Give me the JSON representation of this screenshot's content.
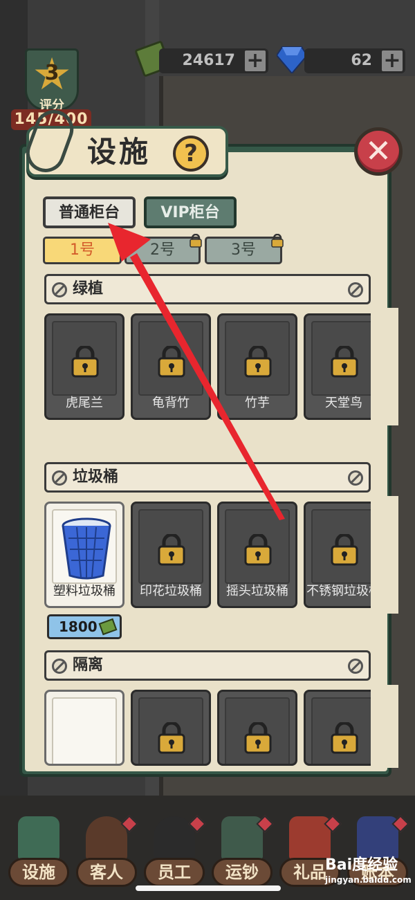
{
  "hud": {
    "rating_level": "3",
    "rating_label": "评分",
    "rating_score": "145/400",
    "cash_amount": "24617",
    "gems_amount": "62"
  },
  "panel": {
    "title": "设施",
    "help_symbol": "?",
    "close_symbol": "✕",
    "counter_tabs": [
      {
        "label": "普通柜台",
        "selected": true
      },
      {
        "label": "VIP柜台",
        "selected": false
      }
    ],
    "slot_tabs": [
      {
        "label": "1号",
        "selected": true,
        "locked": false
      },
      {
        "label": "2号",
        "selected": false,
        "locked": true
      },
      {
        "label": "3号",
        "selected": false,
        "locked": true
      }
    ],
    "sections": [
      {
        "label": "绿植",
        "items": [
          {
            "name": "虎尾兰",
            "locked": true
          },
          {
            "name": "龟背竹",
            "locked": true
          },
          {
            "name": "竹芋",
            "locked": true
          },
          {
            "name": "天堂鸟",
            "locked": true
          }
        ]
      },
      {
        "label": "垃圾桶",
        "items": [
          {
            "name": "塑料垃圾桶",
            "locked": false
          },
          {
            "name": "印花垃圾桶",
            "locked": true
          },
          {
            "name": "摇头垃圾桶",
            "locked": true
          },
          {
            "name": "不锈钢垃圾桶",
            "locked": true
          }
        ],
        "price": "1800"
      },
      {
        "label": "隔离",
        "items": [
          {
            "name": "",
            "locked": false
          },
          {
            "name": "",
            "locked": true
          },
          {
            "name": "",
            "locked": true
          },
          {
            "name": "",
            "locked": true
          }
        ]
      }
    ]
  },
  "bottom_nav": [
    {
      "label": "设施"
    },
    {
      "label": "客人"
    },
    {
      "label": "员工"
    },
    {
      "label": "运钞"
    },
    {
      "label": "礼品"
    },
    {
      "label": "账本"
    }
  ],
  "watermark": {
    "logo": "Bai度经验",
    "url": "jingyan.baidu.com"
  },
  "colors": {
    "accent_red": "#c8404a",
    "panel_green": "#355848",
    "selected_slot": "#f8d878",
    "arrow_red": "#e8262e"
  }
}
